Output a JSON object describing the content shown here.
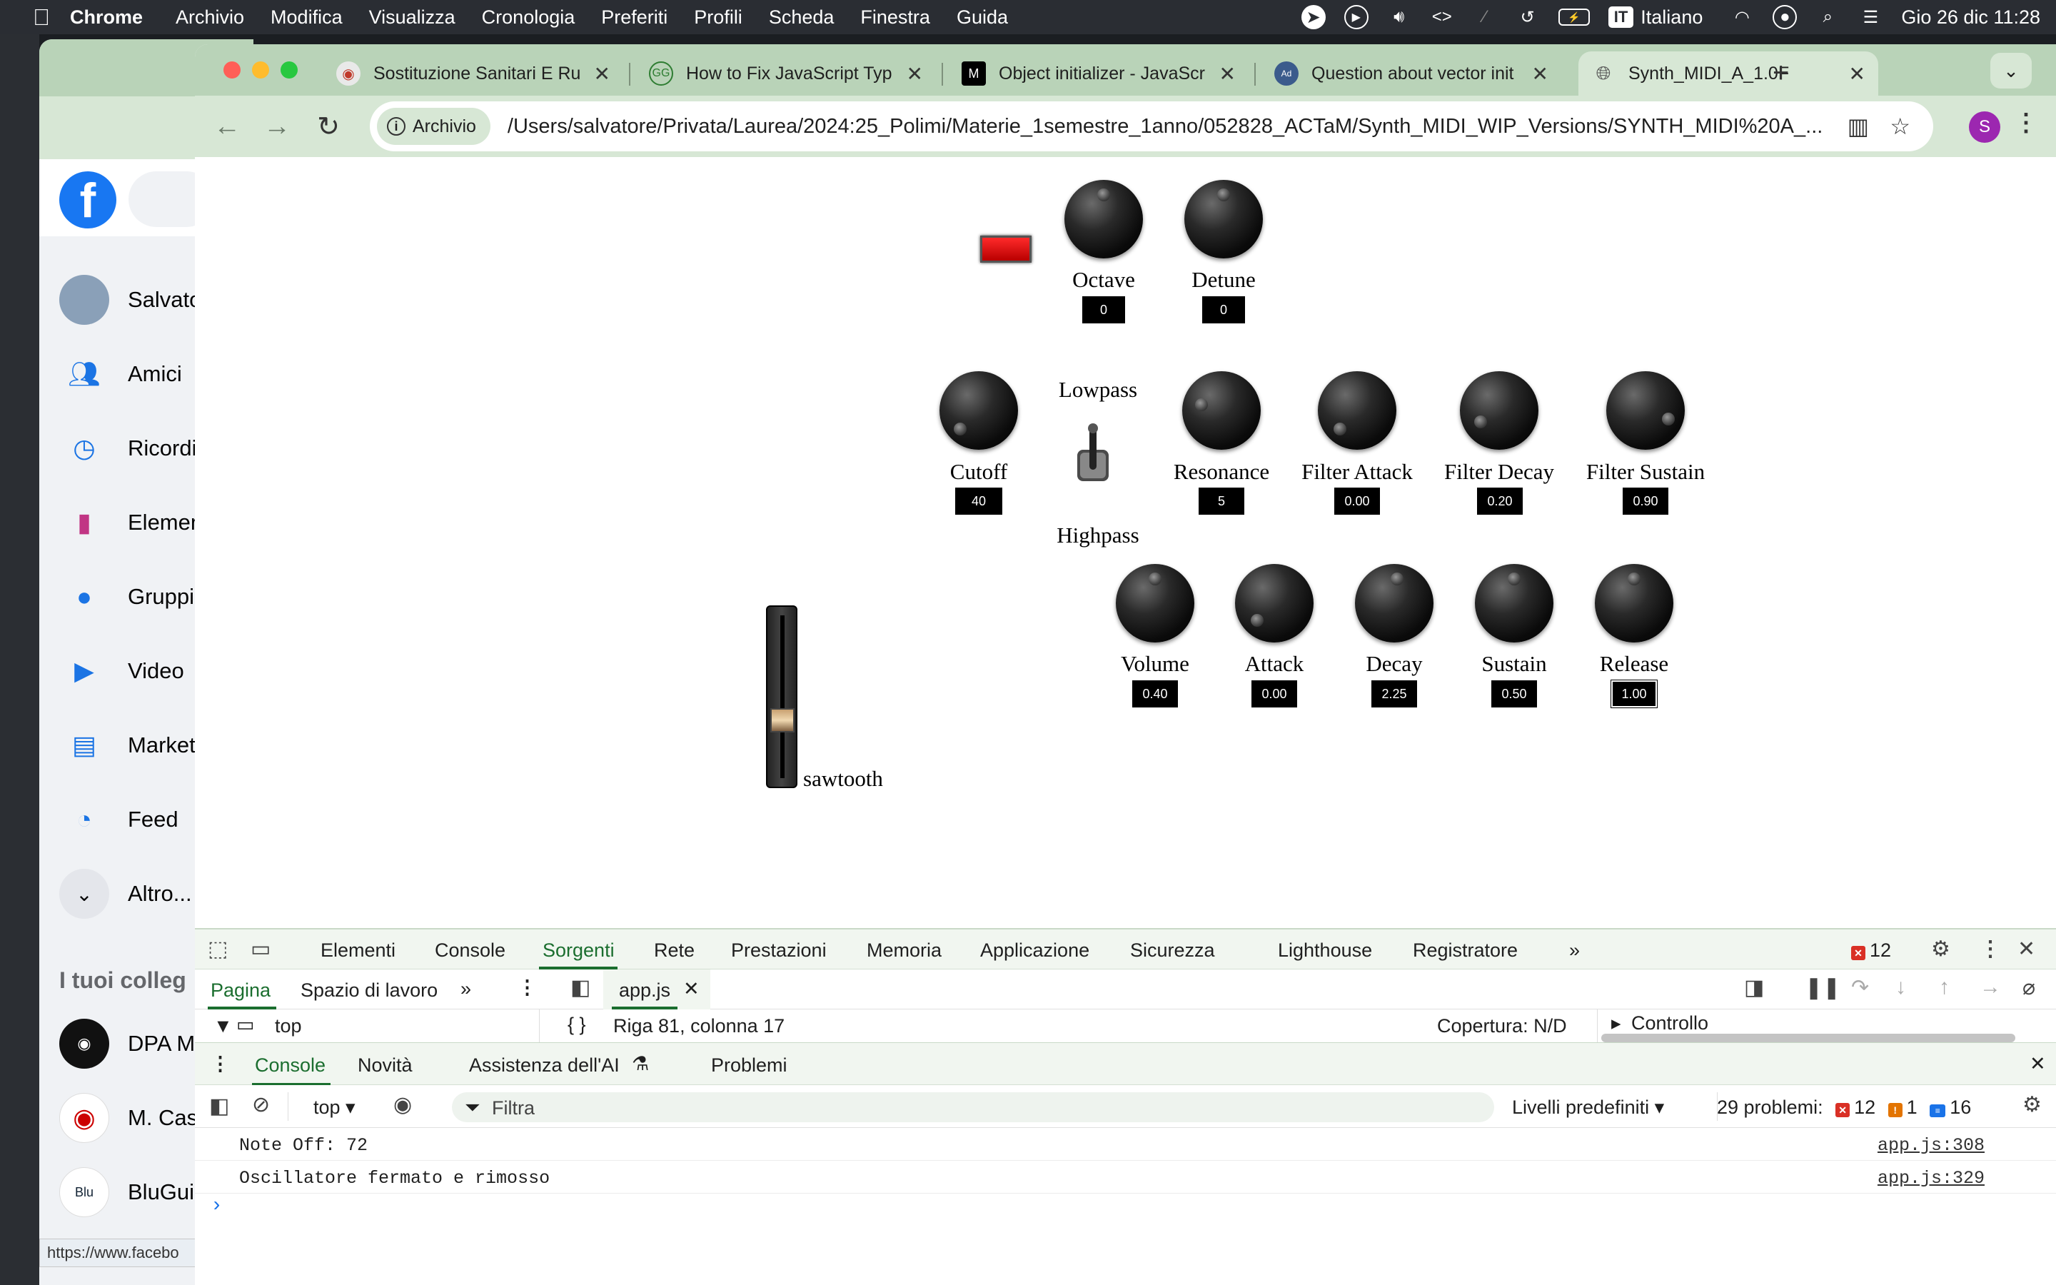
{
  "menubar": {
    "app": "Chrome",
    "items": [
      "Archivio",
      "Modifica",
      "Visualizza",
      "Cronologia",
      "Preferiti",
      "Profili",
      "Scheda",
      "Finestra",
      "Guida"
    ],
    "input_badge": "IT",
    "input_lang": "Italiano",
    "datetime": "Gio 26 dic  11:28"
  },
  "fb": {
    "items": [
      {
        "label": "Salvato",
        "icon": "avatar"
      },
      {
        "label": "Amici",
        "icon": "friends-icon"
      },
      {
        "label": "Ricordi",
        "icon": "memories-icon"
      },
      {
        "label": "Elemen",
        "icon": "saved-icon"
      },
      {
        "label": "Gruppi",
        "icon": "groups-icon"
      },
      {
        "label": "Video",
        "icon": "video-icon"
      },
      {
        "label": "Market",
        "icon": "marketplace-icon"
      },
      {
        "label": "Feed",
        "icon": "feed-icon"
      },
      {
        "label": "Altro...",
        "icon": "chevron-down-icon"
      }
    ],
    "section_title": "I tuoi colleg",
    "shortcuts": [
      "DPA M",
      "M. Cas",
      "BluGui"
    ],
    "status_url": "https://www.facebo"
  },
  "tabs": [
    {
      "title": "Sostituzione Sanitari E Ru",
      "active": false
    },
    {
      "title": "How to Fix JavaScript Typ",
      "active": false
    },
    {
      "title": "Object initializer - JavaScr",
      "active": false
    },
    {
      "title": "Question about vector init",
      "active": false
    },
    {
      "title": "Synth_MIDI_A_1.0F",
      "active": true
    }
  ],
  "omnibox": {
    "chip": "Archivio",
    "url": "/Users/salvatore/Privata/Laurea/2024:25_Polimi/Materie_1semestre_1anno/052828_ACTaM/Synth_MIDI_WIP_Versions/SYNTH_MIDI%20A_..."
  },
  "profile_initial": "S",
  "synth": {
    "top_knobs": [
      {
        "label": "Octave",
        "value": "0"
      },
      {
        "label": "Detune",
        "value": "0"
      }
    ],
    "filter_toggle": {
      "top_label": "Lowpass",
      "bottom_label": "Highpass"
    },
    "filter_knobs": [
      {
        "label": "Cutoff",
        "value": "40"
      },
      {
        "label": "Resonance",
        "value": "5"
      },
      {
        "label": "Filter Attack",
        "value": "0.00"
      },
      {
        "label": "Filter Decay",
        "value": "0.20"
      },
      {
        "label": "Filter Sustain",
        "value": "0.90"
      }
    ],
    "waveform_label": "sawtooth",
    "amp_knobs": [
      {
        "label": "Volume",
        "value": "0.40"
      },
      {
        "label": "Attack",
        "value": "0.00"
      },
      {
        "label": "Decay",
        "value": "2.25"
      },
      {
        "label": "Sustain",
        "value": "0.50"
      },
      {
        "label": "Release",
        "value": "1.00"
      }
    ]
  },
  "devtools": {
    "tabs": [
      "Elementi",
      "Console",
      "Sorgenti",
      "Rete",
      "Prestazioni",
      "Memoria",
      "Applicazione",
      "Sicurezza",
      "Lighthouse",
      "Registratore"
    ],
    "selected_tab": "Sorgenti",
    "error_count": "12",
    "sources": {
      "left_tabs": [
        "Pagina",
        "Spazio di lavoro"
      ],
      "file_tab": "app.js",
      "tree_root": "top",
      "position": "Riga 81, colonna 17",
      "coverage": "Copertura: N/D",
      "debugger_section": "Controllo"
    },
    "drawer_tabs": [
      "Console",
      "Novità",
      "Assistenza dell'AI",
      "Problemi"
    ],
    "console": {
      "context": "top",
      "filter_placeholder": "Filtra",
      "levels": "Livelli predefiniti",
      "problems_label": "29 problemi:",
      "errors": "12",
      "warnings": "1",
      "info": "16",
      "logs": [
        {
          "message": "Note Off: 72",
          "source": "app.js:308"
        },
        {
          "message": "Oscillatore fermato e rimosso",
          "source": "app.js:329"
        }
      ],
      "prompt": "›"
    }
  }
}
